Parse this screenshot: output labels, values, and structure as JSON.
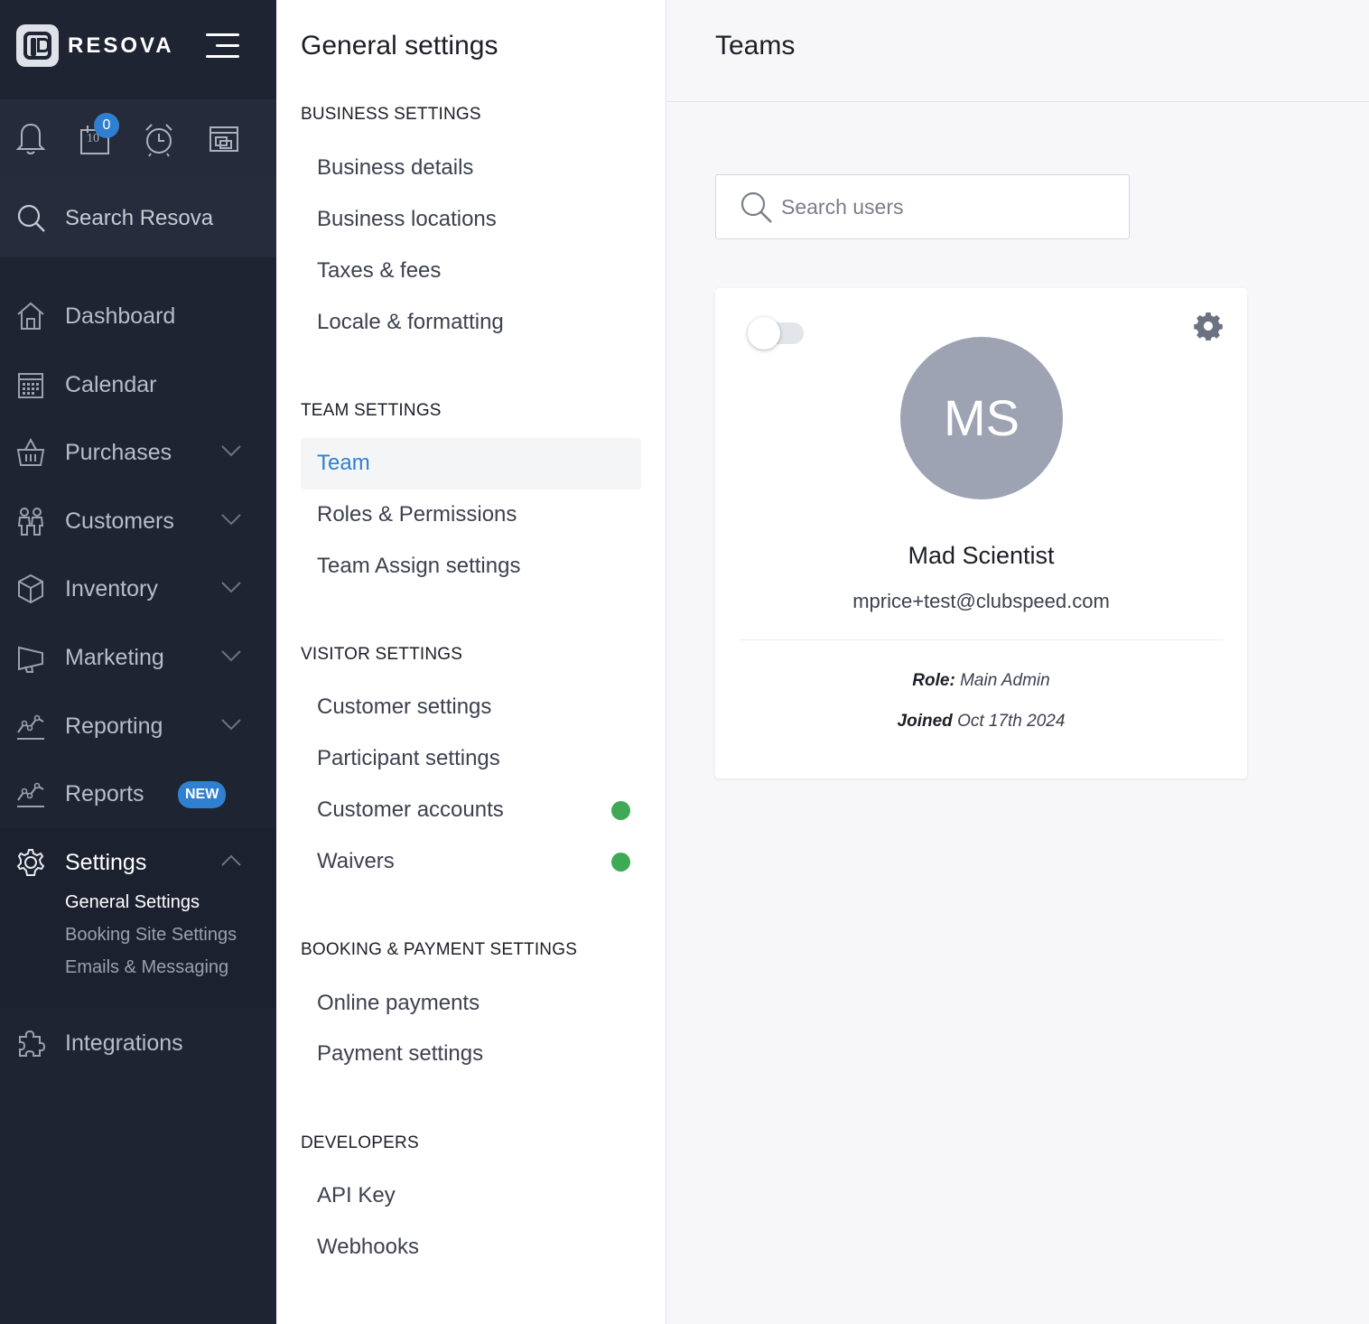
{
  "app": {
    "brand": "RESOVA",
    "notifications_badge": "0",
    "calendar_icon_day": "10",
    "search_label": "Search Resova"
  },
  "sidebar": {
    "items": [
      {
        "label": "Dashboard",
        "icon": "home-icon"
      },
      {
        "label": "Calendar",
        "icon": "calendar-icon"
      },
      {
        "label": "Purchases",
        "icon": "basket-icon"
      },
      {
        "label": "Customers",
        "icon": "people-icon"
      },
      {
        "label": "Inventory",
        "icon": "box-icon"
      },
      {
        "label": "Marketing",
        "icon": "megaphone-icon"
      },
      {
        "label": "Reporting",
        "icon": "chart-icon"
      },
      {
        "label": "Reports",
        "icon": "chart-icon",
        "badge": "NEW"
      },
      {
        "label": "Settings",
        "icon": "gear-icon"
      },
      {
        "label": "Integrations",
        "icon": "puzzle-icon"
      }
    ],
    "settings_sub": [
      "General Settings",
      "Booking Site Settings",
      "Emails & Messaging"
    ]
  },
  "general": {
    "title": "General settings",
    "sections": {
      "business": {
        "heading": "BUSINESS SETTINGS",
        "items": [
          "Business details",
          "Business locations",
          "Taxes & fees",
          "Locale & formatting"
        ]
      },
      "team": {
        "heading": "TEAM SETTINGS",
        "items": [
          "Team",
          "Roles & Permissions",
          "Team Assign settings"
        ]
      },
      "visitor": {
        "heading": "VISITOR SETTINGS",
        "items": [
          "Customer settings",
          "Participant settings",
          "Customer accounts",
          "Waivers"
        ]
      },
      "booking": {
        "heading": "BOOKING & PAYMENT SETTINGS",
        "items": [
          "Online payments",
          "Payment settings"
        ]
      },
      "developers": {
        "heading": "DEVELOPERS",
        "items": [
          "API Key",
          "Webhooks"
        ]
      }
    }
  },
  "teams": {
    "title": "Teams",
    "search_placeholder": "Search users",
    "user": {
      "initials": "MS",
      "name": "Mad Scientist",
      "email": "mprice+test@clubspeed.com",
      "role_label": "Role:",
      "role": "Main Admin",
      "joined_label": "Joined",
      "joined": "Oct 17th 2024",
      "active": false
    }
  },
  "colors": {
    "sidebar_bg": "#1f2433",
    "accent": "#2f80d1",
    "status_green": "#3eaa55",
    "avatar_bg": "#9ea3b3"
  }
}
